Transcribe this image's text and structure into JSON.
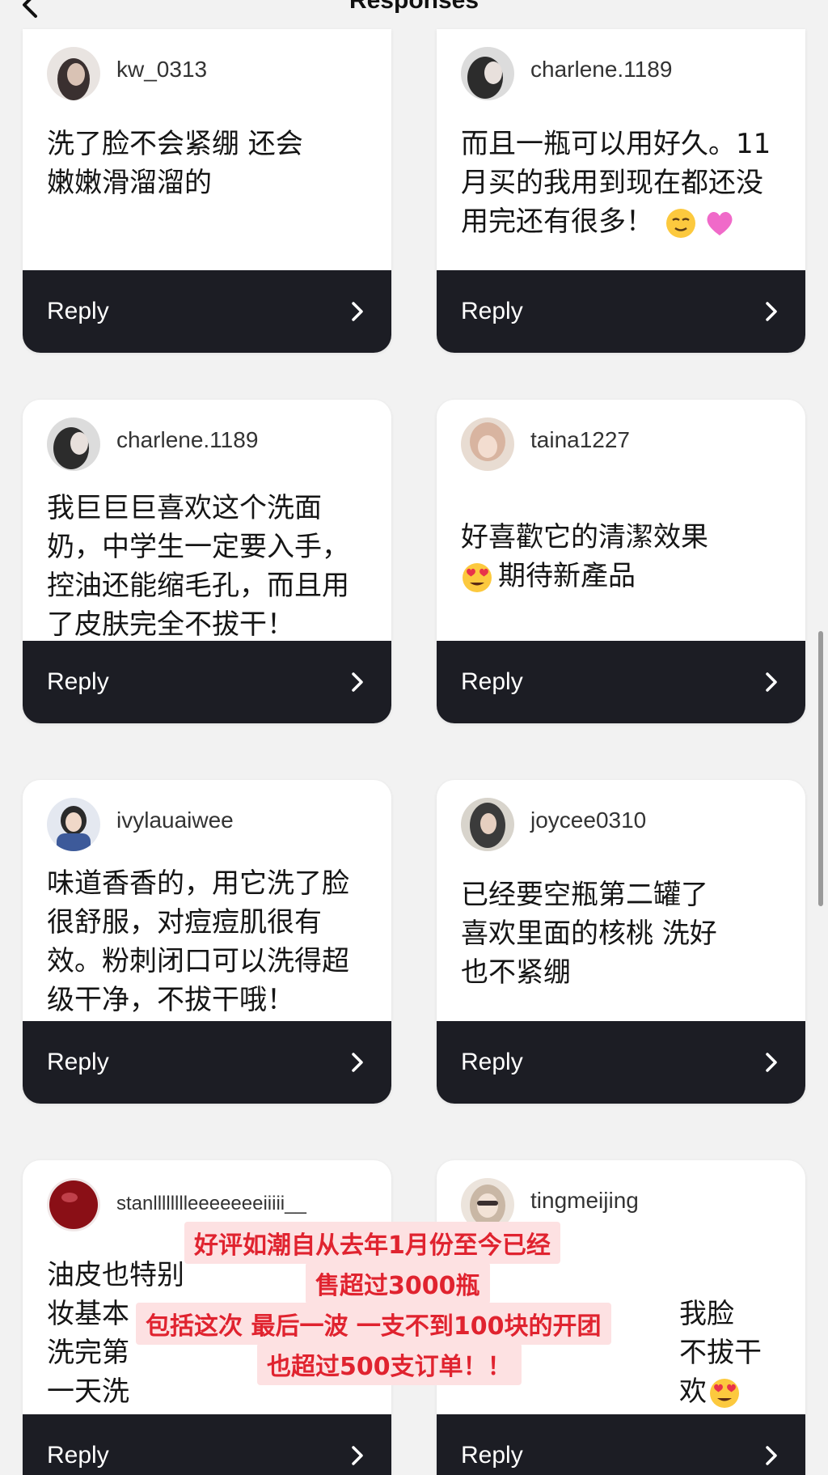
{
  "header": {
    "title": "Responses",
    "back_icon": "chevron-left-icon"
  },
  "cards": [
    {
      "username": "kw_0313",
      "comment": "洗了脸不会紧绷 还会\n嫩嫩滑溜溜的",
      "reply_label": "Reply",
      "avatar_color": "#3a3030"
    },
    {
      "username": "charlene.1189",
      "comment": "而且一瓶可以用好久。11\n月买的我用到现在都还没\n用完还有很多！",
      "emojis": [
        "relieved-face-emoji",
        "pink-heart-emoji"
      ],
      "reply_label": "Reply",
      "avatar_color": "#2c2c2c"
    },
    {
      "username": "charlene.1189",
      "comment": "我巨巨巨喜欢这个洗面\n奶，中学生一定要入手，\n控油还能缩毛孔，而且用\n了皮肤完全不拔干！",
      "reply_label": "Reply",
      "avatar_color": "#2c2c2c"
    },
    {
      "username": "taina1227",
      "comment": "好喜歡它的清潔效果\n期待新產品",
      "emojis": [
        "heart-eyes-emoji"
      ],
      "reply_label": "Reply",
      "avatar_color": "#d8b4a0"
    },
    {
      "username": "ivylauaiwee",
      "comment": "味道香香的，用它洗了脸\n很舒服，对痘痘肌很有\n效。粉刺闭口可以洗得超\n级干净，不拔干哦！",
      "reply_label": "Reply",
      "avatar_color": "#3d5a9a"
    },
    {
      "username": "joycee0310",
      "comment": "已经要空瓶第二罐了\n喜欢里面的核桃 洗好\n也不紧绷",
      "reply_label": "Reply",
      "avatar_color": "#3b3b3b"
    },
    {
      "username": "stanlllllllleeeeeeeiiiii__",
      "comment": "油皮也特别\n妆基本\n洗完第\n一天洗",
      "reply_label": "Reply",
      "avatar_color": "#8a0f16"
    },
    {
      "username": "tingmeijing",
      "comment": "\n我脸\n不拔干\n欢",
      "emojis": [
        "heart-eyes-emoji"
      ],
      "reply_label": "Reply",
      "avatar_color": "#c9b7a5"
    }
  ],
  "overlay": {
    "lines": [
      "好评如潮自从去年1月份至今已经",
      "售超过3000瓶",
      "包括这次 最后一波 一支不到100块的开团",
      "也超过500支订单！！"
    ],
    "text_color": "#e0232f",
    "background_color": "#fde1e2"
  },
  "colors": {
    "reply_bar": "#1c1d24",
    "card_background": "#ffffff",
    "page_background": "#f2f2f2"
  }
}
